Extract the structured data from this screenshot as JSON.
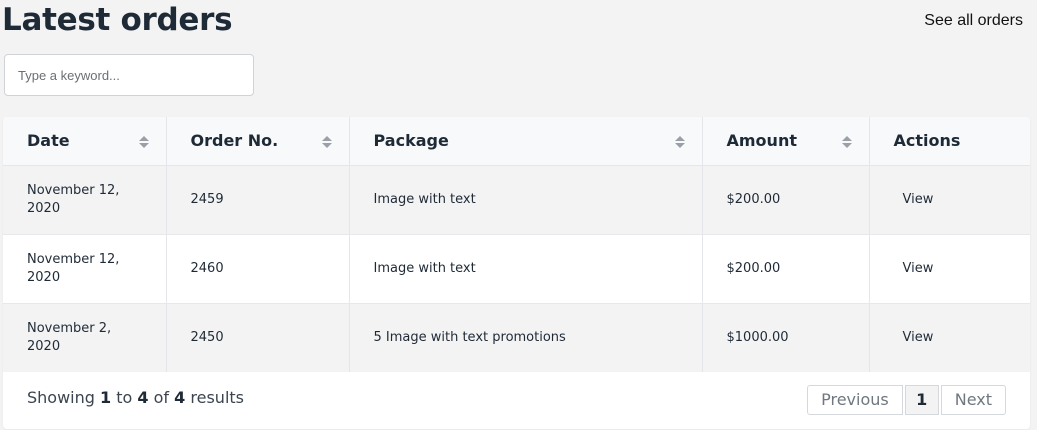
{
  "header": {
    "title": "Latest orders",
    "see_all_label": "See all orders"
  },
  "search": {
    "placeholder": "Type a keyword...",
    "value": ""
  },
  "table": {
    "columns": [
      {
        "label": "Date",
        "sortable": true
      },
      {
        "label": "Order No.",
        "sortable": true
      },
      {
        "label": "Package",
        "sortable": true
      },
      {
        "label": "Amount",
        "sortable": true
      },
      {
        "label": "Actions",
        "sortable": false
      }
    ],
    "rows": [
      {
        "date": "November 12, 2020",
        "order_no": "2459",
        "package": "Image with text",
        "amount": "$200.00",
        "action": "View"
      },
      {
        "date": "November 12, 2020",
        "order_no": "2460",
        "package": "Image with text",
        "amount": "$200.00",
        "action": "View"
      },
      {
        "date": "November 2, 2020",
        "order_no": "2450",
        "package": "5 Image with text promotions",
        "amount": "$1000.00",
        "action": "View"
      }
    ]
  },
  "footer": {
    "showing_prefix": "Showing",
    "from": "1",
    "to_word": "to",
    "to": "4",
    "of_word": "of",
    "total": "4",
    "results_word": "results",
    "pagination": {
      "previous_label": "Previous",
      "current_page": "1",
      "next_label": "Next"
    }
  },
  "icons": {
    "sort": "sort-icon"
  }
}
